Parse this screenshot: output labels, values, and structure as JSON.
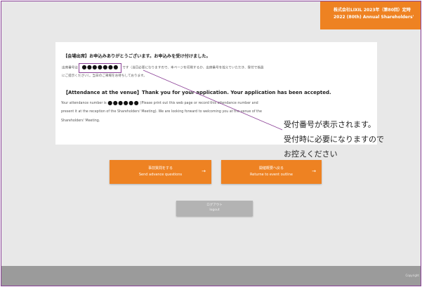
{
  "header": {
    "company_line1": "株式会社LIXIL 2023年（第80回）定時",
    "company_line2": "2022 (80th) Annual Shareholders'"
  },
  "notice_jp": {
    "title": "【会場出席】お申込みありがとうございます。お申込みを受け付けました。",
    "line1_prefix": "出席番号は",
    "number_mask": "●●●●●●●",
    "line1_suffix": "です（当日必要になりますので、本ページを印刷するか、出席番号を控えていただき、受付で係員",
    "line2": "にご提示ください）。当日のご来場をお待ちしております。"
  },
  "notice_en": {
    "title": "【Attendance at the venue】Thank you for your application. Your application has been accepted.",
    "line1_prefix": "Your attendance number is",
    "number_mask": "●●●●●●",
    "line1_suffix": "(Please print out this web page or record this attendance number and",
    "line2": "present it at the reception of the Shareholders' Meeting). We are looking forward to welcoming you at the venue of the",
    "line3": "Shareholders' Meeting."
  },
  "annotation": {
    "line1": "受付番号が表示されます。",
    "line2": "受付時に必要になりますので",
    "line3": "お控えください"
  },
  "buttons": {
    "advance_q_jp": "事前質問をする",
    "advance_q_en": "Send advance questions",
    "return_jp": "開催概要へ戻る",
    "return_en": "Returne to event outline",
    "arrow": "→",
    "logout_jp": "ログアウト",
    "logout_en": "logout"
  },
  "footer": {
    "copyright": "Copyright"
  },
  "colors": {
    "accent": "#ee8222",
    "frame": "#8a3f96",
    "background": "#e8e8e8",
    "footer": "#9b9b9b"
  }
}
